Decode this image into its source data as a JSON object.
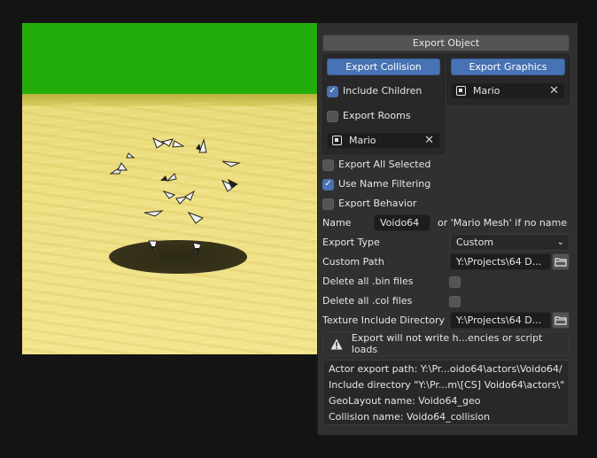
{
  "panel": {
    "export_object_label": "Export Object",
    "collision": {
      "button_label": "Export Collision",
      "include_children_label": "Include Children",
      "include_children_checked": true,
      "export_rooms_label": "Export Rooms",
      "export_rooms_checked": false,
      "object_value": "Mario"
    },
    "graphics": {
      "button_label": "Export Graphics",
      "object_value": "Mario"
    },
    "export_all_selected_label": "Export All Selected",
    "use_name_filtering_label": "Use Name Filtering",
    "export_behavior_label": "Export Behavior",
    "name_label": "Name",
    "name_value": "Voido64",
    "name_hint": "or 'Mario Mesh' if no name",
    "export_type_label": "Export Type",
    "export_type_value": "Custom",
    "custom_path_label": "Custom Path",
    "custom_path_value": "Y:\\Projects\\64 D...",
    "delete_bin_label": "Delete all .bin files",
    "delete_col_label": "Delete all .col files",
    "texture_dir_label": "Texture Include Directory",
    "texture_dir_value": "Y:\\Projects\\64 D...",
    "warning_text": "Export will not write h...encies or script loads",
    "info_lines": [
      "Actor export path: Y:\\Pr...oido64\\actors\\Voido64/",
      "Include directory \"Y:\\Pr...m\\[CS] Voido64\\actors\\\"",
      "GeoLayout name: Voido64_geo",
      "Collision name: Voido64_collision"
    ]
  },
  "colors": {
    "accent": "#4772b3",
    "panel_bg": "#303030",
    "field_bg": "#1d1d1d",
    "sky": "#22ad0a",
    "ground": "#ecde80"
  },
  "icons": {
    "checkbox_checked": "check-icon",
    "object": "object-icon",
    "clear": "close-icon",
    "folder": "folder-icon",
    "warning": "warning-icon",
    "dropdown": "chevron-down-icon"
  }
}
